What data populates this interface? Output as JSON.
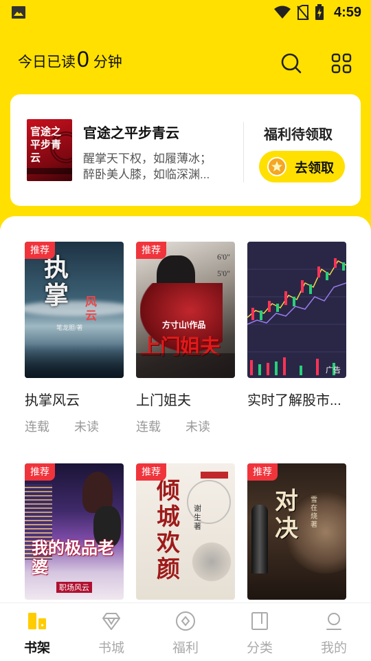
{
  "status_bar": {
    "time": "4:59"
  },
  "header": {
    "read_prefix": "今日已读",
    "read_minutes": "0",
    "read_unit": "分钟"
  },
  "promo": {
    "cover_title": "官途之平步青云",
    "title": "官途之平步青云",
    "desc_line1": "醒掌天下权，如履薄冰；",
    "desc_line2": "醉卧美人膝，如临深渊..."
  },
  "welfare": {
    "title": "福利待领取",
    "button_label": "去领取"
  },
  "books": [
    {
      "title": "执掌风云",
      "tag": "推荐",
      "status": "连载",
      "read_state": "未读",
      "cover_text": "执掌",
      "cover_sub": "风云",
      "cover_author": "笔龙胆/著"
    },
    {
      "title": "上门姐夫",
      "tag": "推荐",
      "status": "连载",
      "read_state": "未读",
      "cover_text": "上门姐夫",
      "cover_sub": "方寸山\\作品"
    },
    {
      "title": "实时了解股市...",
      "ad_label": "广告"
    },
    {
      "tag": "推荐",
      "cover_text": "我的极品老婆",
      "cover_sub": "职场风云"
    },
    {
      "tag": "推荐",
      "cover_text": "倾城欢颜",
      "cover_sub": "谢生著"
    },
    {
      "tag": "推荐",
      "cover_text": "对决",
      "cover_sub": "雪在烧著"
    }
  ],
  "nav": [
    {
      "label": "书架",
      "icon": "bookshelf-icon",
      "active": true
    },
    {
      "label": "书城",
      "icon": "diamond-icon"
    },
    {
      "label": "福利",
      "icon": "welfare-icon"
    },
    {
      "label": "分类",
      "icon": "category-icon"
    },
    {
      "label": "我的",
      "icon": "profile-icon"
    }
  ],
  "colors": {
    "accent": "#ffe000",
    "tag": "#f0343c"
  }
}
